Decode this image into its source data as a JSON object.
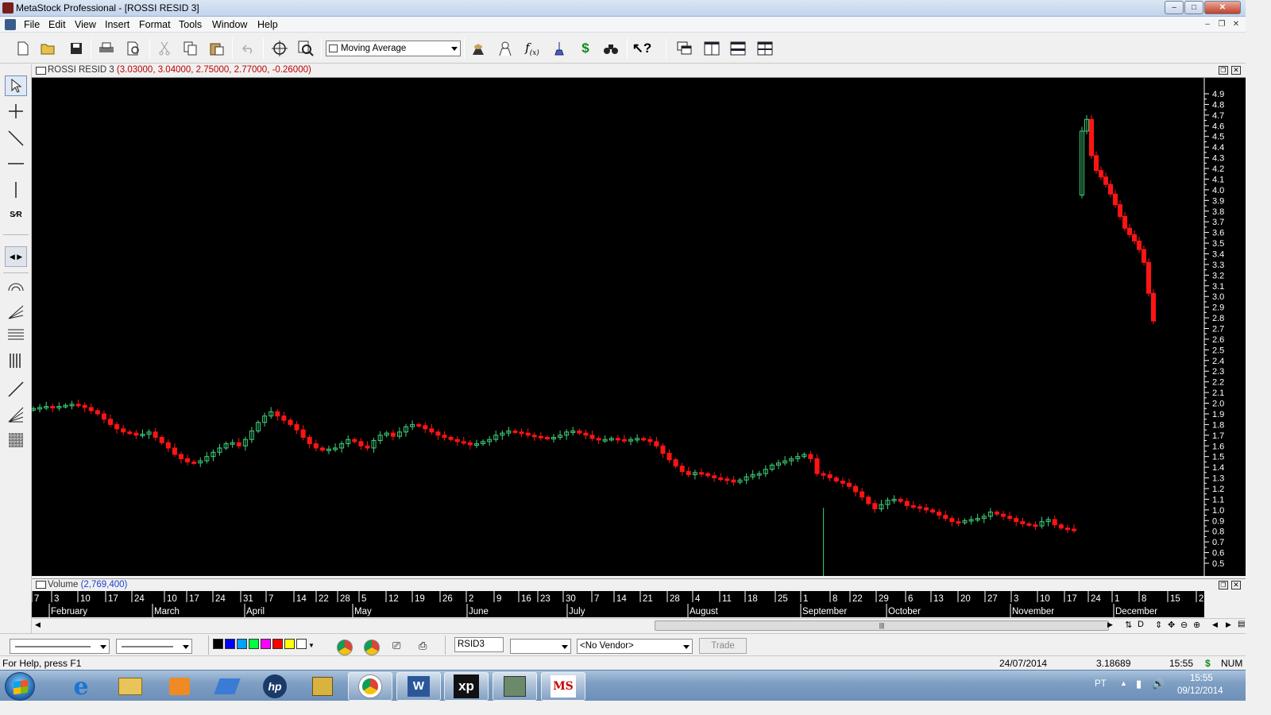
{
  "window": {
    "title": "MetaStock Professional - [ROSSI RESID 3]"
  },
  "menu": [
    "File",
    "Edit",
    "View",
    "Insert",
    "Format",
    "Tools",
    "Window",
    "Help"
  ],
  "toolbar": {
    "indicator_select": "Moving Average"
  },
  "chart": {
    "security_name": "ROSSI RESID 3",
    "ohlc_values": "(3.03000, 3.04000, 2.75000, 2.77000, -0.26000)",
    "colors": {
      "up": "#3fd07a",
      "down": "#ff1414",
      "background": "#000000",
      "axis_text": "#ffffff"
    },
    "y_ticks": [
      "4.9",
      "4.8",
      "4.7",
      "4.6",
      "4.5",
      "4.4",
      "4.3",
      "4.2",
      "4.1",
      "4.0",
      "3.9",
      "3.8",
      "3.7",
      "3.6",
      "3.5",
      "3.4",
      "3.3",
      "3.2",
      "3.1",
      "3.0",
      "2.9",
      "2.8",
      "2.7",
      "2.6",
      "2.5",
      "2.4",
      "2.3",
      "2.2",
      "2.1",
      "2.0",
      "1.9",
      "1.8",
      "1.7",
      "1.6",
      "1.5",
      "1.4",
      "1.3",
      "1.2",
      "1.1",
      "1.0",
      "0.9",
      "0.8",
      "0.7",
      "0.6",
      "0.5"
    ]
  },
  "chart_data": {
    "type": "candlestick",
    "ylim": [
      0.4,
      5.0
    ],
    "y_ticks": [
      4.9,
      4.8,
      4.7,
      4.6,
      4.5,
      4.4,
      4.3,
      4.2,
      4.1,
      4.0,
      3.9,
      3.8,
      3.7,
      3.6,
      3.5,
      3.4,
      3.3,
      3.2,
      3.1,
      3.0,
      2.9,
      2.8,
      2.7,
      2.6,
      2.5,
      2.4,
      2.3,
      2.2,
      2.1,
      2.0,
      1.9,
      1.8,
      1.7,
      1.6,
      1.5,
      1.4,
      1.3,
      1.2,
      1.1,
      1.0,
      0.9,
      0.8,
      0.7,
      0.6,
      0.5
    ],
    "close_path": [
      1.95,
      1.96,
      1.97,
      1.96,
      1.97,
      1.98,
      1.99,
      1.98,
      1.96,
      1.93,
      1.9,
      1.85,
      1.8,
      1.76,
      1.73,
      1.72,
      1.7,
      1.71,
      1.73,
      1.68,
      1.63,
      1.58,
      1.52,
      1.48,
      1.45,
      1.44,
      1.46,
      1.5,
      1.54,
      1.58,
      1.62,
      1.63,
      1.6,
      1.66,
      1.74,
      1.82,
      1.88,
      1.92,
      1.88,
      1.84,
      1.8,
      1.75,
      1.68,
      1.62,
      1.58,
      1.56,
      1.57,
      1.58,
      1.62,
      1.66,
      1.64,
      1.6,
      1.58,
      1.65,
      1.7,
      1.72,
      1.69,
      1.73,
      1.78,
      1.8,
      1.79,
      1.76,
      1.73,
      1.7,
      1.68,
      1.66,
      1.64,
      1.63,
      1.61,
      1.62,
      1.64,
      1.66,
      1.7,
      1.72,
      1.74,
      1.73,
      1.72,
      1.7,
      1.69,
      1.68,
      1.67,
      1.68,
      1.7,
      1.73,
      1.74,
      1.72,
      1.7,
      1.67,
      1.66,
      1.66,
      1.67,
      1.66,
      1.65,
      1.66,
      1.67,
      1.66,
      1.64,
      1.6,
      1.53,
      1.47,
      1.41,
      1.36,
      1.33,
      1.35,
      1.34,
      1.32,
      1.3,
      1.29,
      1.28,
      1.26,
      1.28,
      1.31,
      1.33,
      1.34,
      1.38,
      1.42,
      1.44,
      1.46,
      1.48,
      1.5,
      1.52,
      1.48,
      1.34,
      1.33,
      1.3,
      1.27,
      1.25,
      1.22,
      1.17,
      1.12,
      1.06,
      1.01,
      1.05,
      1.09,
      1.1,
      1.08,
      1.04,
      1.03,
      1.02,
      1.0,
      0.98,
      0.95,
      0.92,
      0.89,
      0.88,
      0.9,
      0.91,
      0.92,
      0.94,
      0.98,
      0.96,
      0.94,
      0.92,
      0.89,
      0.87,
      0.86,
      0.85,
      0.89,
      0.91,
      0.86,
      0.83,
      0.82,
      0.81
    ],
    "late_closes": [
      4.55,
      4.66,
      4.32,
      4.18,
      4.12,
      4.05,
      3.96,
      3.86,
      3.75,
      3.64,
      3.58,
      3.52,
      3.44,
      3.32,
      3.03,
      2.77
    ],
    "x_ticks": [
      "7",
      "3",
      "10",
      "17",
      "24",
      "10",
      "17",
      "24",
      "31",
      "7",
      "14",
      "22",
      "28",
      "5",
      "12",
      "19",
      "26",
      "2",
      "9",
      "16",
      "23",
      "30",
      "7",
      "14",
      "21",
      "28",
      "4",
      "11",
      "18",
      "25",
      "1",
      "8",
      "22",
      "29",
      "6",
      "13",
      "20",
      "27",
      "3",
      "10",
      "17",
      "24",
      "1",
      "8",
      "15",
      "2"
    ],
    "months": [
      "February",
      "March",
      "April",
      "May",
      "June",
      "July",
      "August",
      "September",
      "October",
      "November",
      "December"
    ]
  },
  "volume": {
    "label": "Volume",
    "value": "(2,769,400)"
  },
  "bottom": {
    "symbol": "RSID3",
    "vendor": "<No Vendor>",
    "trade": "Trade",
    "period": ""
  },
  "status": {
    "help": "For Help, press F1",
    "date": "24/07/2014",
    "value": "3.18689",
    "time": "15:55",
    "currency": "$",
    "num": "NUM"
  },
  "taskbar": {
    "lang": "PT",
    "clock_time": "15:55",
    "clock_date": "09/12/2014"
  }
}
